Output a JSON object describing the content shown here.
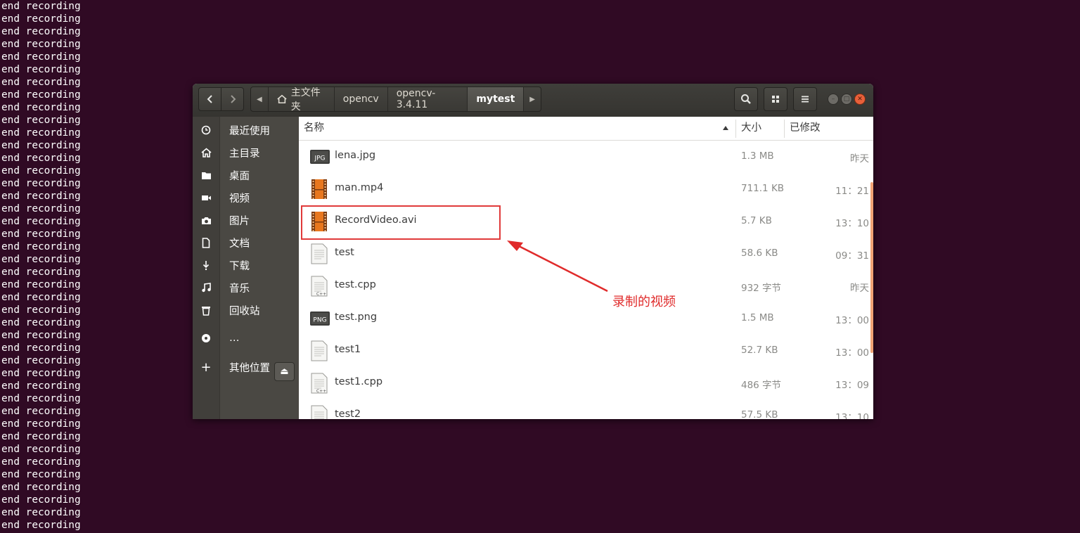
{
  "terminal": {
    "line_text": "end recording",
    "line_count": 42
  },
  "headerbar": {
    "back_icon": "chevron-left-icon",
    "forward_icon": "chevron-right-icon",
    "breadcrumbs": [
      {
        "label": "主文件夹",
        "icon": "home-icon"
      },
      {
        "label": "opencv"
      },
      {
        "label": "opencv-3.4.11"
      },
      {
        "label": "mytest",
        "active": true
      }
    ],
    "search_icon": "search-icon",
    "view_icon": "grid-view-icon",
    "menu_icon": "hamburger-menu-icon"
  },
  "sidebar": {
    "items": [
      {
        "label": "最近使用",
        "icon": "clock-icon"
      },
      {
        "label": "主目录",
        "icon": "home-icon"
      },
      {
        "label": "桌面",
        "icon": "folder-icon"
      },
      {
        "label": "视频",
        "icon": "video-camera-icon"
      },
      {
        "label": "图片",
        "icon": "camera-icon"
      },
      {
        "label": "文档",
        "icon": "document-icon"
      },
      {
        "label": "下载",
        "icon": "download-icon"
      },
      {
        "label": "音乐",
        "icon": "music-icon"
      },
      {
        "label": "回收站",
        "icon": "trash-icon"
      },
      {
        "label": "…",
        "icon": "disc-icon"
      },
      {
        "label": "其他位置",
        "icon": "plus-icon"
      }
    ]
  },
  "list": {
    "columns": {
      "name": "名称",
      "size": "大小",
      "modified": "已修改"
    },
    "files": [
      {
        "name": "lena.jpg",
        "size": "1.3 MB",
        "modified": "昨天",
        "icon": "jpg-file-icon"
      },
      {
        "name": "man.mp4",
        "size": "711.1 KB",
        "modified": "11：21",
        "icon": "video-file-icon"
      },
      {
        "name": "RecordVideo.avi",
        "size": "5.7 KB",
        "modified": "13：10",
        "icon": "video-file-icon"
      },
      {
        "name": "test",
        "size": "58.6 KB",
        "modified": "09：31",
        "icon": "text-file-icon"
      },
      {
        "name": "test.cpp",
        "size": "932 字节",
        "modified": "昨天",
        "icon": "cpp-file-icon"
      },
      {
        "name": "test.png",
        "size": "1.5 MB",
        "modified": "13：00",
        "icon": "png-file-icon"
      },
      {
        "name": "test1",
        "size": "52.7 KB",
        "modified": "13：00",
        "icon": "text-file-icon"
      },
      {
        "name": "test1.cpp",
        "size": "486 字节",
        "modified": "13：09",
        "icon": "cpp-file-icon"
      },
      {
        "name": "test2",
        "size": "57.5 KB",
        "modified": "13：10",
        "icon": "text-file-icon"
      }
    ]
  },
  "annotation": {
    "text": "录制的视频",
    "color": "#e02b2b"
  }
}
